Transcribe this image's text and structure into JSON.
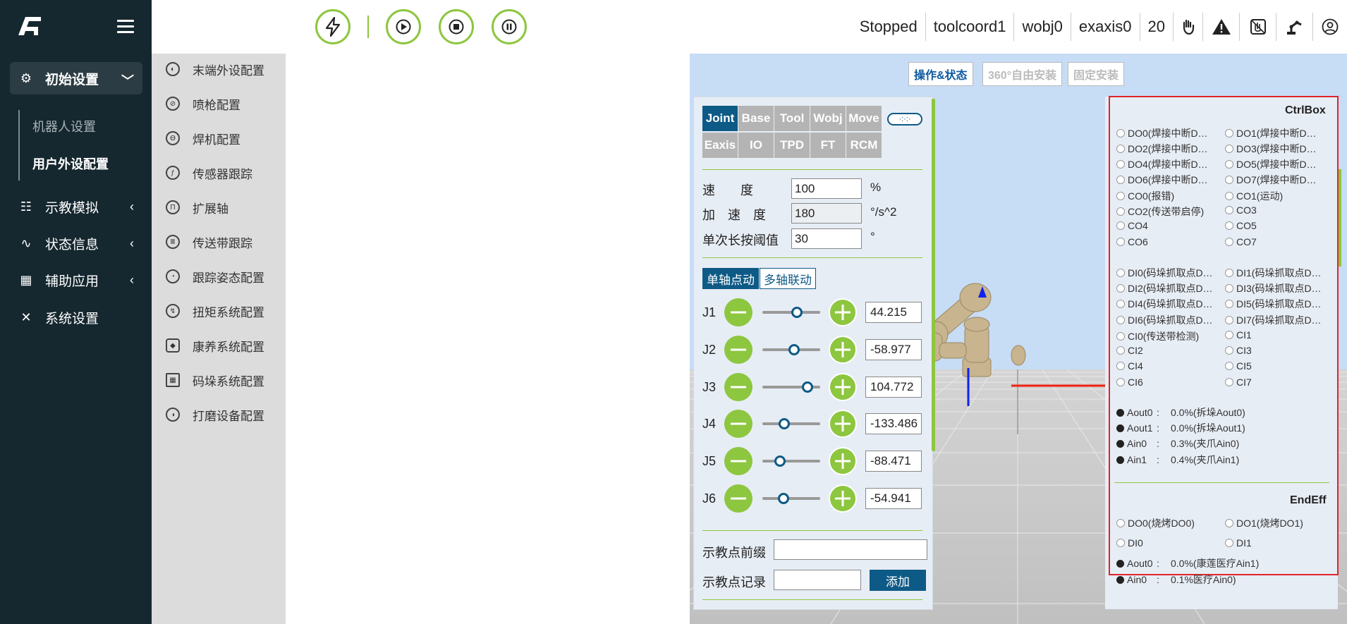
{
  "sidebar": {
    "nav": [
      {
        "label": "初始设置",
        "icon": "gear-icon"
      },
      {
        "label": "示教模拟",
        "icon": "list-icon"
      },
      {
        "label": "状态信息",
        "icon": "pulse-icon"
      },
      {
        "label": "辅助应用",
        "icon": "grid-icon"
      },
      {
        "label": "系统设置",
        "icon": "tools-icon"
      }
    ],
    "sub": [
      "机器人设置",
      "用户外设配置"
    ]
  },
  "submenu": {
    "items": [
      "末端外设配置",
      "喷枪配置",
      "焊机配置",
      "传感器跟踪",
      "扩展轴",
      "传送带跟踪",
      "跟踪姿态配置",
      "扭矩系统配置",
      "康养系统配置",
      "码垛系统配置",
      "打磨设备配置"
    ]
  },
  "topbar": {
    "state": "Stopped",
    "tool": "toolcoord1",
    "wobj": "wobj0",
    "exaxis": "exaxis0",
    "speed": "20"
  },
  "view_tabs": [
    "操作&状态",
    "360°自由安装",
    "固定安装"
  ],
  "jog": {
    "tabs_row1": [
      "Joint",
      "Base",
      "Tool",
      "Wobj",
      "Move"
    ],
    "tabs_row2": [
      "Eaxis",
      "IO",
      "TPD",
      "FT",
      "RCM"
    ],
    "speed_label": "速　　度",
    "speed_value": "100",
    "speed_unit": "%",
    "acc_label": "加　速　度",
    "acc_value": "180",
    "acc_unit": "°/s^2",
    "thresh_label": "单次长按阈值",
    "thresh_value": "30",
    "thresh_unit": "°",
    "mode_single": "单轴点动",
    "mode_multi": "多轴联动",
    "joints": [
      {
        "name": "J1",
        "value": "44.215",
        "pos": 0.6
      },
      {
        "name": "J2",
        "value": "-58.977",
        "pos": 0.55
      },
      {
        "name": "J3",
        "value": "104.772",
        "pos": 0.78
      },
      {
        "name": "J4",
        "value": "-133.486",
        "pos": 0.38
      },
      {
        "name": "J5",
        "value": "-88.471",
        "pos": 0.3
      },
      {
        "name": "J6",
        "value": "-54.941",
        "pos": 0.36
      }
    ],
    "prefix_label": "示教点前缀",
    "record_label": "示教点记录",
    "add_label": "添加"
  },
  "ctrlbox": {
    "title": "CtrlBox",
    "do_left": [
      "DO0(焊接中断D…",
      "DO2(焊接中断D…",
      "DO4(焊接中断D…",
      "DO6(焊接中断D…",
      "CO0(报错)",
      "CO2(传送带启停)",
      "CO4",
      "CO6"
    ],
    "do_right": [
      "DO1(焊接中断D…",
      "DO3(焊接中断D…",
      "DO5(焊接中断D…",
      "DO7(焊接中断D…",
      "CO1(运动)",
      "CO3",
      "CO5",
      "CO7"
    ],
    "di_left": [
      "DI0(码垛抓取点D…",
      "DI2(码垛抓取点D…",
      "DI4(码垛抓取点D…",
      "DI6(码垛抓取点D…",
      "CI0(传送带检测)",
      "CI2",
      "CI4",
      "CI6"
    ],
    "di_right": [
      "DI1(码垛抓取点D…",
      "DI3(码垛抓取点D…",
      "DI5(码垛抓取点D…",
      "DI7(码垛抓取点D…",
      "CI1",
      "CI3",
      "CI5",
      "CI7"
    ],
    "analog": [
      {
        "name": "Aout0",
        "value": "0.0%(拆垛Aout0)"
      },
      {
        "name": "Aout1",
        "value": "0.0%(拆垛Aout1)"
      },
      {
        "name": "Ain0",
        "value": "0.3%(夹爪Ain0)"
      },
      {
        "name": "Ain1",
        "value": "0.4%(夹爪Ain1)"
      }
    ]
  },
  "endeff": {
    "title": "EndEff",
    "do": [
      "DO0(烧烤DO0)",
      "DO1(烧烤DO1)"
    ],
    "di": [
      "DI0",
      "DI1"
    ],
    "analog": [
      {
        "name": "Aout0",
        "value": "0.0%(康莲医疗Ain1)"
      },
      {
        "name": "Ain0",
        "value": "0.1%医疗Ain0)"
      }
    ]
  },
  "colors": {
    "accent": "#8dc63f",
    "primary": "#0d5a86",
    "sidebar": "#15272f",
    "highlight": "#e0242c"
  }
}
